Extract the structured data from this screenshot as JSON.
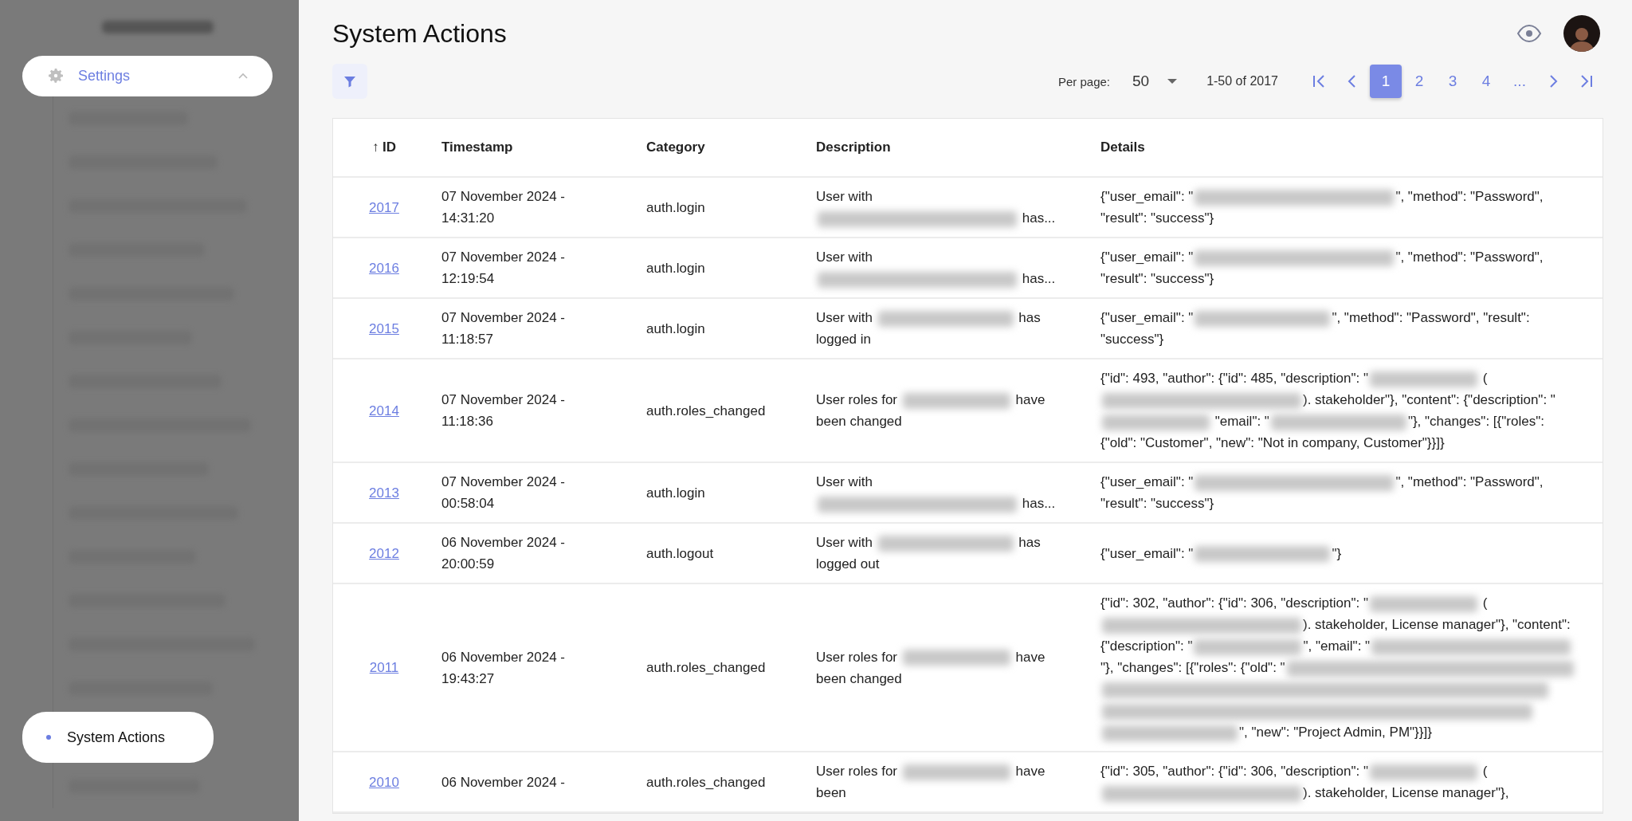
{
  "sidebar": {
    "items": [
      {
        "kind": "blurred"
      },
      {
        "kind": "group",
        "label": "Settings",
        "expanded": true,
        "children": [
          {
            "kind": "blurred"
          },
          {
            "kind": "blurred"
          },
          {
            "kind": "blurred"
          },
          {
            "kind": "blurred"
          },
          {
            "kind": "blurred"
          },
          {
            "kind": "blurred"
          },
          {
            "kind": "blurred"
          },
          {
            "kind": "blurred"
          },
          {
            "kind": "blurred"
          },
          {
            "kind": "blurred"
          },
          {
            "kind": "blurred"
          },
          {
            "kind": "blurred"
          },
          {
            "kind": "blurred"
          },
          {
            "kind": "blurred"
          },
          {
            "kind": "item",
            "label": "System Actions",
            "selected": true
          },
          {
            "kind": "blurred"
          }
        ]
      }
    ]
  },
  "header": {
    "title": "System Actions"
  },
  "toolbar": {
    "per_page_label": "Per page:",
    "per_page": "50",
    "range": "1-50 of 2017",
    "pages": [
      {
        "label": "1",
        "selected": true
      },
      {
        "label": "2",
        "selected": false
      },
      {
        "label": "3",
        "selected": false
      },
      {
        "label": "4",
        "selected": false
      },
      {
        "label": "...",
        "selected": false
      }
    ]
  },
  "table": {
    "columns": [
      {
        "label": "ID",
        "sort_arrow": "↑"
      },
      {
        "label": "Timestamp"
      },
      {
        "label": "Category"
      },
      {
        "label": "Description"
      },
      {
        "label": "Details"
      }
    ],
    "rows": [
      {
        "id": "2017",
        "timestamp": [
          "07 November 2024 -",
          "14:31:20"
        ],
        "category": "auth.login",
        "description": [
          {
            "kind": "text",
            "text": "User with "
          },
          {
            "kind": "blur-wide"
          },
          {
            "kind": "text",
            "text": " has..."
          }
        ],
        "details": [
          {
            "kind": "text",
            "text": "{\"user_email\": \""
          },
          {
            "kind": "blur-wide"
          },
          {
            "kind": "text",
            "text": "\", \"method\": \"Password\", \"result\": \"success\"}"
          }
        ]
      },
      {
        "id": "2016",
        "timestamp": [
          "07 November 2024 -",
          "12:19:54"
        ],
        "category": "auth.login",
        "description": [
          {
            "kind": "text",
            "text": "User with "
          },
          {
            "kind": "blur-wide"
          },
          {
            "kind": "text",
            "text": " has..."
          }
        ],
        "details": [
          {
            "kind": "text",
            "text": "{\"user_email\": \""
          },
          {
            "kind": "blur-wide"
          },
          {
            "kind": "text",
            "text": "\", \"method\": \"Password\", \"result\": \"success\"}"
          }
        ]
      },
      {
        "id": "2015",
        "timestamp": [
          "07 November 2024 -",
          "11:18:57"
        ],
        "category": "auth.login",
        "description": [
          {
            "kind": "text",
            "text": "User with "
          },
          {
            "kind": "blur-medium"
          },
          {
            "kind": "text",
            "text": " has logged in"
          }
        ],
        "details": [
          {
            "kind": "text",
            "text": "{\"user_email\": \""
          },
          {
            "kind": "blur-medium"
          },
          {
            "kind": "text",
            "text": "\", \"method\": \"Password\", \"result\": \"success\"}"
          }
        ]
      },
      {
        "id": "2014",
        "timestamp": [
          "07 November 2024 -",
          "11:18:36"
        ],
        "category": "auth.roles_changed",
        "description": [
          {
            "kind": "text",
            "text": "User roles for "
          },
          {
            "kind": "blur-narrow"
          },
          {
            "kind": "text",
            "text": " have been changed"
          }
        ],
        "details": [
          {
            "kind": "text",
            "text": "{\"id\": 493, \"author\": {\"id\": 485, \"description\": \""
          },
          {
            "kind": "blur-narrow"
          },
          {
            "kind": "text",
            "text": " ("
          },
          {
            "kind": "blur-wide"
          },
          {
            "kind": "text",
            "text": "). stakeholder\"}, \"content\": {\"description\": \""
          },
          {
            "kind": "blur-narrow"
          },
          {
            "kind": "text",
            "text": " \"email\": \""
          },
          {
            "kind": "blur-medium"
          },
          {
            "kind": "text",
            "text": "\"}, \"changes\": [{\"roles\": {\"old\": \"Customer\", \"new\": \"Not in company, Customer\"}}]}"
          }
        ]
      },
      {
        "id": "2013",
        "timestamp": [
          "07 November 2024 -",
          "00:58:04"
        ],
        "category": "auth.login",
        "description": [
          {
            "kind": "text",
            "text": "User with "
          },
          {
            "kind": "blur-wide"
          },
          {
            "kind": "text",
            "text": " has..."
          }
        ],
        "details": [
          {
            "kind": "text",
            "text": "{\"user_email\": \""
          },
          {
            "kind": "blur-wide"
          },
          {
            "kind": "text",
            "text": "\", \"method\": \"Password\", \"result\": \"success\"}"
          }
        ]
      },
      {
        "id": "2012",
        "timestamp": [
          "06 November 2024 -",
          "20:00:59"
        ],
        "category": "auth.logout",
        "description": [
          {
            "kind": "text",
            "text": "User with "
          },
          {
            "kind": "blur-medium"
          },
          {
            "kind": "text",
            "text": " has logged out"
          }
        ],
        "details": [
          {
            "kind": "text",
            "text": "{\"user_email\": \""
          },
          {
            "kind": "blur-medium"
          },
          {
            "kind": "text",
            "text": "\"}"
          }
        ]
      },
      {
        "id": "2011",
        "timestamp": [
          "06 November 2024 -",
          "19:43:27"
        ],
        "category": "auth.roles_changed",
        "description": [
          {
            "kind": "text",
            "text": "User roles for "
          },
          {
            "kind": "blur-narrow"
          },
          {
            "kind": "text",
            "text": " have been changed"
          }
        ],
        "details": [
          {
            "kind": "text",
            "text": "{\"id\": 302, \"author\": {\"id\": 306, \"description\": \""
          },
          {
            "kind": "blur-narrow"
          },
          {
            "kind": "text",
            "text": " ("
          },
          {
            "kind": "blur-wide"
          },
          {
            "kind": "text",
            "text": "). stakeholder, License manager\"}, \"content\": {\"description\": \""
          },
          {
            "kind": "blur-narrow"
          },
          {
            "kind": "text",
            "text": "\", \"email\": \""
          },
          {
            "kind": "blur-wide"
          },
          {
            "kind": "text",
            "text": "\"}, \"changes\": [{\"roles\": {\"old\": \""
          },
          {
            "kind": "blur-block"
          },
          {
            "kind": "text",
            "text": "\", \"new\": \"Project Admin, PM\"}}]}"
          }
        ]
      },
      {
        "id": "2010",
        "timestamp": [
          "06 November 2024 -"
        ],
        "category": "auth.roles_changed",
        "description": [
          {
            "kind": "text",
            "text": "User roles for "
          },
          {
            "kind": "blur-narrow"
          },
          {
            "kind": "text",
            "text": " have been"
          }
        ],
        "details": [
          {
            "kind": "text",
            "text": "{\"id\": 305, \"author\": {\"id\": 306, \"description\": \""
          },
          {
            "kind": "blur-narrow"
          },
          {
            "kind": "text",
            "text": " ("
          },
          {
            "kind": "blur-wide"
          },
          {
            "kind": "text",
            "text": "). stakeholder, License manager\"},"
          }
        ]
      }
    ]
  }
}
